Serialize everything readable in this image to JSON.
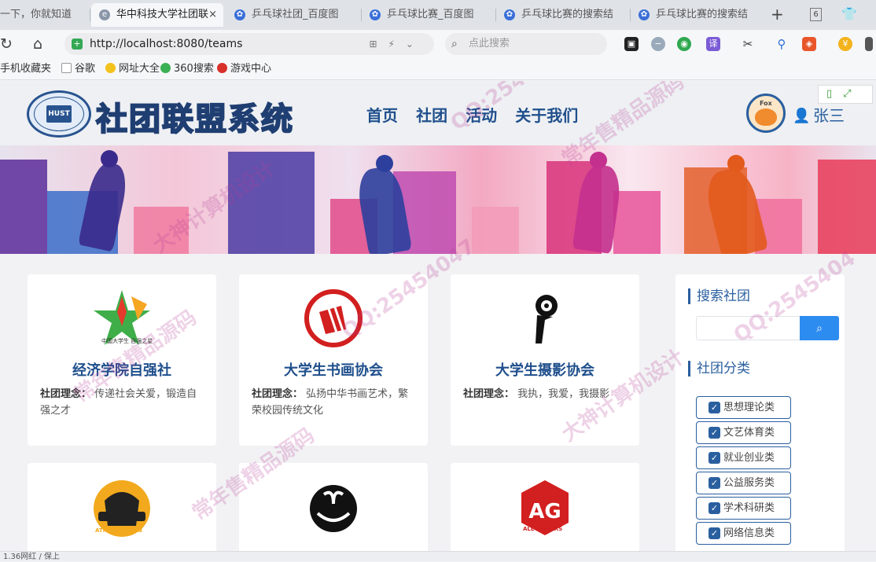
{
  "browser": {
    "tabs": [
      {
        "label": "一下，你就知道",
        "icon": "baidu-icon",
        "active": false
      },
      {
        "label": "华中科技大学社团联",
        "icon": "ie-icon",
        "active": true,
        "close": "×"
      },
      {
        "label": "乒乓球社团_百度图",
        "icon": "baidu-icon",
        "active": false
      },
      {
        "label": "乒乓球比赛_百度图",
        "icon": "baidu-icon",
        "active": false
      },
      {
        "label": "乒乓球比赛的搜索结",
        "icon": "baidu-icon",
        "active": false
      },
      {
        "label": "乒乓球比赛的搜索结",
        "icon": "baidu-icon",
        "active": false
      }
    ],
    "new_tab": "+",
    "tab_count": "6",
    "url": "http://localhost:8080/teams",
    "search_placeholder": "点此搜索",
    "ext_translate": "译",
    "bookmarks": [
      "手机收藏夹",
      "谷歌",
      "网址大全",
      "360搜索",
      "游戏中心"
    ],
    "status_left": "1.36网红 / 保上"
  },
  "site": {
    "title": "社团联盟系统",
    "logo_text": "HUST",
    "nav": [
      "首页",
      "社团",
      "活动",
      "关于我们"
    ],
    "avatar_tag": "Fox",
    "username": "张三"
  },
  "cards": [
    {
      "name": "经济学院自强社",
      "idea_label": "社团理念：",
      "idea": "传递社会关爱，锻造自强之才",
      "logo": "star-logo",
      "logo_caption": "中国大学生 自强之星"
    },
    {
      "name": "大学生书画协会",
      "idea_label": "社团理念：",
      "idea": "弘扬中华书画艺术，繁荣校园传统文化",
      "logo": "calligraphy-logo"
    },
    {
      "name": "大学生摄影协会",
      "idea_label": "社团理念：",
      "idea": "我执，我爱，我摄影",
      "logo": "camera-logo"
    },
    {
      "name": "",
      "logo": "athletic-club-logo",
      "logo_caption": "ATHLETIC CLUB"
    },
    {
      "name": "",
      "logo": "swan-logo"
    },
    {
      "name": "",
      "logo": "ag-logo",
      "logo_caption": "ALL GAMERS"
    }
  ],
  "sidebar": {
    "search_title": "搜索社团",
    "search_value": "",
    "category_title": "社团分类",
    "categories": [
      "思想理论类",
      "文艺体育类",
      "就业创业类",
      "公益服务类",
      "学术科研类",
      "网络信息类"
    ]
  },
  "watermarks": [
    "QQ:2545404",
    "常年售精品源码",
    "大神计算机设计",
    "QQ:25454047",
    "常年售精品源码",
    "大神计算机设计",
    "QQ:2545404",
    "常年售精品源码"
  ],
  "colors": {
    "brand": "#1f4f8c",
    "accent": "#2d8cf0"
  }
}
